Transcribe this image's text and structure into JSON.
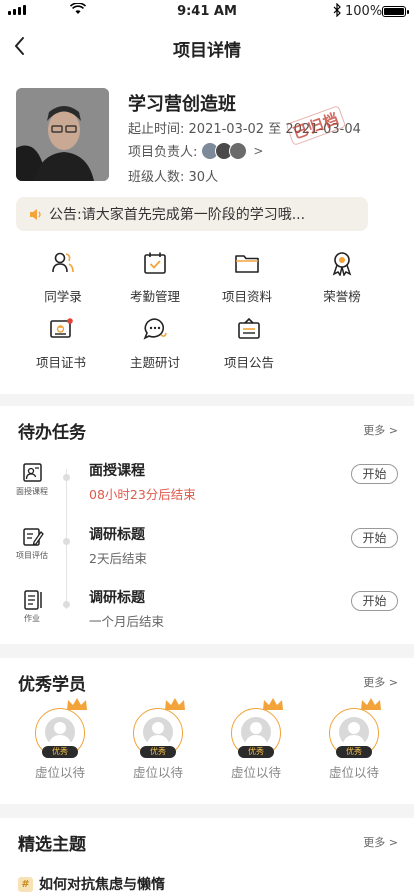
{
  "status_bar": {
    "time": "9:41 AM",
    "battery": "100%"
  },
  "nav": {
    "title": "项目详情"
  },
  "project": {
    "name": "学习营创造班",
    "period_label": "起止时间:",
    "period": "2021-03-02 至 2021-03-04",
    "owner_label": "项目负责人:",
    "class_size_label": "班级人数:",
    "class_size": "30人",
    "stamp": "已归档"
  },
  "notice": {
    "text": "公告:请大家首先完成第一阶段的学习哦..."
  },
  "features": [
    {
      "label": "同学录",
      "icon": "classmates-icon"
    },
    {
      "label": "考勤管理",
      "icon": "attendance-icon"
    },
    {
      "label": "项目资料",
      "icon": "folder-icon"
    },
    {
      "label": "荣誉榜",
      "icon": "medal-icon"
    },
    {
      "label": "项目证书",
      "icon": "certificate-icon"
    },
    {
      "label": "主题研讨",
      "icon": "discussion-icon"
    },
    {
      "label": "项目公告",
      "icon": "announcement-icon"
    }
  ],
  "todo": {
    "title": "待办任务",
    "more": "更多",
    "items": [
      {
        "tag": "面授课程",
        "title": "面授课程",
        "subtitle": "08小时23分后结束",
        "action": "开始"
      },
      {
        "tag": "项目评估",
        "title": "调研标题",
        "subtitle": "2天后结束",
        "action": "开始"
      },
      {
        "tag": "作业",
        "title": "调研标题",
        "subtitle": "一个月后结束",
        "action": "开始"
      }
    ]
  },
  "students": {
    "title": "优秀学员",
    "more": "更多",
    "items": [
      {
        "badge": "优秀",
        "name": "虚位以待"
      },
      {
        "badge": "优秀",
        "name": "虚位以待"
      },
      {
        "badge": "优秀",
        "name": "虚位以待"
      },
      {
        "badge": "优秀",
        "name": "虚位以待"
      }
    ]
  },
  "topics": {
    "title": "精选主题",
    "more": "更多",
    "items": [
      {
        "icon": "#",
        "title": "如何对抗焦虑与懒惰"
      }
    ]
  },
  "colors": {
    "accent": "#f2a33a",
    "warning_text": "#e05a4e",
    "stamp": "#c0392b"
  }
}
